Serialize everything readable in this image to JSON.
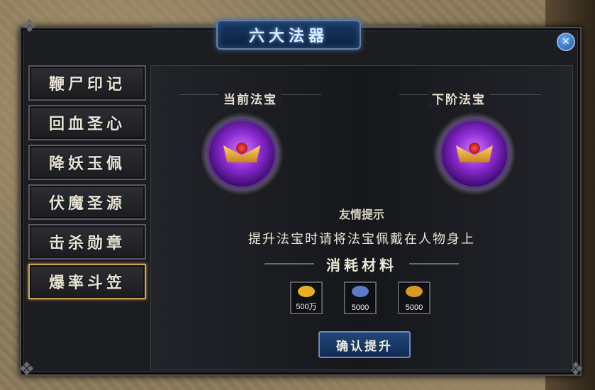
{
  "window": {
    "title": "六大法器",
    "close_glyph": "✕"
  },
  "sidebar": {
    "items": [
      {
        "label": "鞭尸印记",
        "active": false
      },
      {
        "label": "回血圣心",
        "active": false
      },
      {
        "label": "降妖玉佩",
        "active": false
      },
      {
        "label": "伏魔圣源",
        "active": false
      },
      {
        "label": "击杀勋章",
        "active": false
      },
      {
        "label": "爆率斗笠",
        "active": true
      }
    ]
  },
  "main": {
    "current_label": "当前法宝",
    "next_label": "下阶法宝",
    "tip_title": "友情提示",
    "tip_text": "提升法宝时请将法宝佩戴在人物身上",
    "materials_title": "消耗材料",
    "materials": [
      {
        "icon": "gold-coins-icon",
        "count": "500万",
        "color": "#e8b020"
      },
      {
        "icon": "blue-ore-icon",
        "count": "5000",
        "color": "#5a7cc8"
      },
      {
        "icon": "gold-medal-icon",
        "count": "5000",
        "color": "#d89a20"
      }
    ],
    "confirm_label": "确认提升"
  },
  "colors": {
    "accent_gold": "#c9a45a",
    "title_blue": "#1a3a64",
    "orb_purple": "#8a2ad0"
  }
}
